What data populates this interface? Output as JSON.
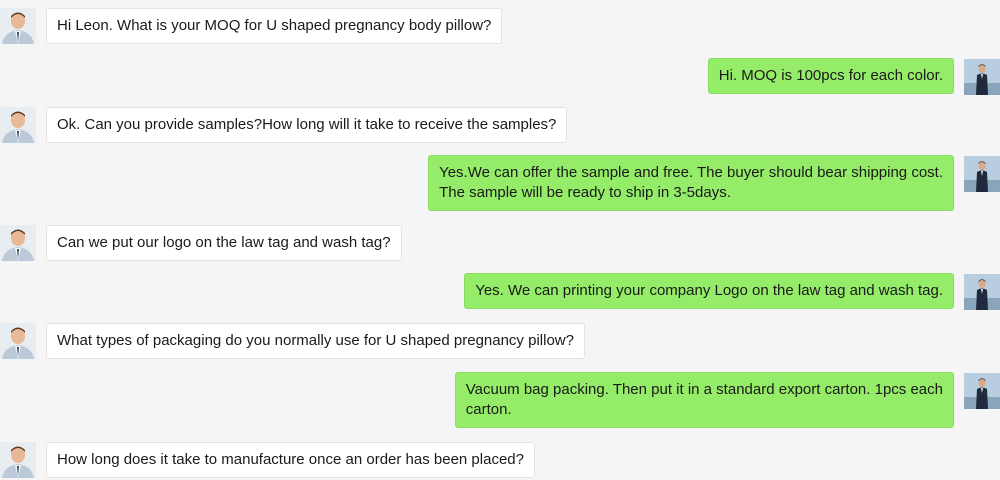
{
  "colors": {
    "background": "#f5f5f5",
    "incoming_bubble": "#ffffff",
    "outgoing_bubble": "#95ec69"
  },
  "messages": [
    {
      "side": "left",
      "avatar": "customer-avatar",
      "text": "Hi Leon. What is your MOQ for U shaped pregnancy body pillow?"
    },
    {
      "side": "right",
      "avatar": "leon-avatar",
      "text": "Hi. MOQ is 100pcs for each color."
    },
    {
      "side": "left",
      "avatar": "customer-avatar",
      "text": "Ok. Can you provide samples?How long will it take to receive the samples?"
    },
    {
      "side": "right",
      "avatar": "leon-avatar",
      "text": "Yes.We can offer the sample and free. The buyer should bear shipping cost.\nThe sample will be ready to ship in 3-5days."
    },
    {
      "side": "left",
      "avatar": "customer-avatar",
      "text": "Can we put our logo on the law tag and wash tag?"
    },
    {
      "side": "right",
      "avatar": "leon-avatar",
      "text": "Yes. We can printing your company Logo on the law tag and wash tag."
    },
    {
      "side": "left",
      "avatar": "customer-avatar",
      "text": "What types of packaging do you normally use for U shaped pregnancy pillow?"
    },
    {
      "side": "right",
      "avatar": "leon-avatar",
      "text": "Vacuum bag packing. Then put it in a standard export carton. 1pcs each\ncarton."
    },
    {
      "side": "left",
      "avatar": "customer-avatar",
      "text": "How long does it take to manufacture once an order has been placed?"
    }
  ]
}
